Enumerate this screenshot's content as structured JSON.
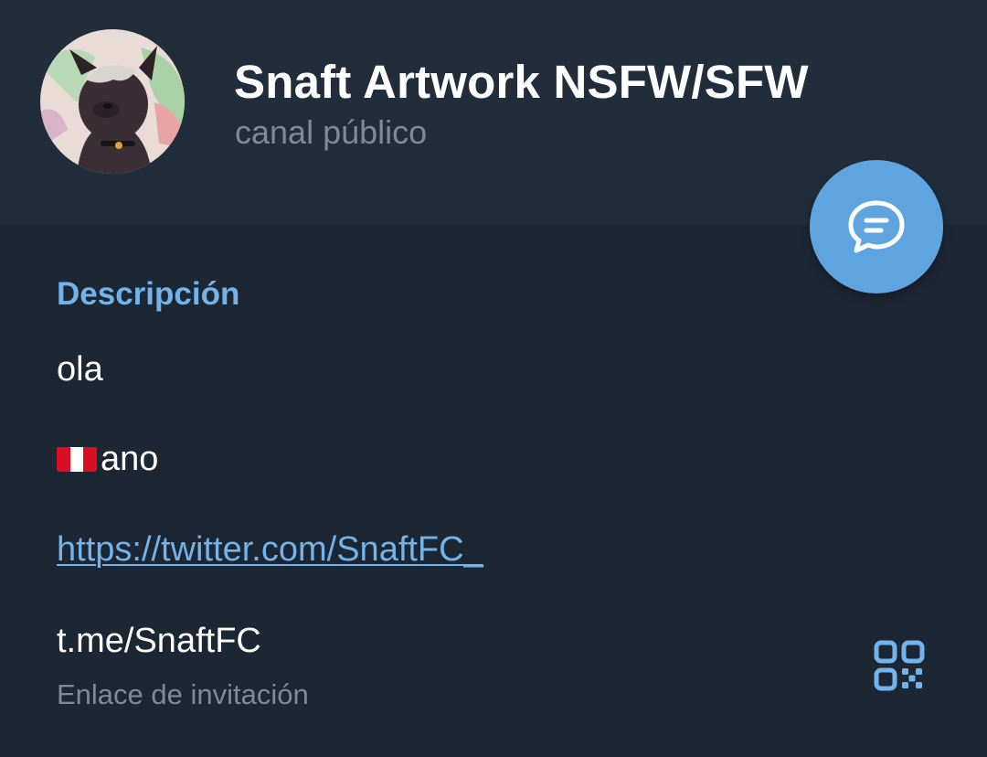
{
  "header": {
    "title": "Snaft Artwork NSFW/SFW",
    "subtitle": "canal público",
    "avatar_icon": "avatar-wolf-artwork"
  },
  "fab": {
    "icon": "chat-bubble-icon",
    "color": "#5ea5e0"
  },
  "description": {
    "section_title": "Descripción",
    "lines": [
      "ola",
      "ano",
      "https://twitter.com/SnaftFC_"
    ],
    "flag_icon": "peru-flag-icon"
  },
  "invite": {
    "link": "t.me/SnaftFC",
    "caption": "Enlace de invitación",
    "qr_icon": "qr-code-icon"
  },
  "colors": {
    "background": "#1d2733",
    "header_bg": "#212d3b",
    "accent": "#71b3ea",
    "muted_text": "#7d8b99"
  }
}
